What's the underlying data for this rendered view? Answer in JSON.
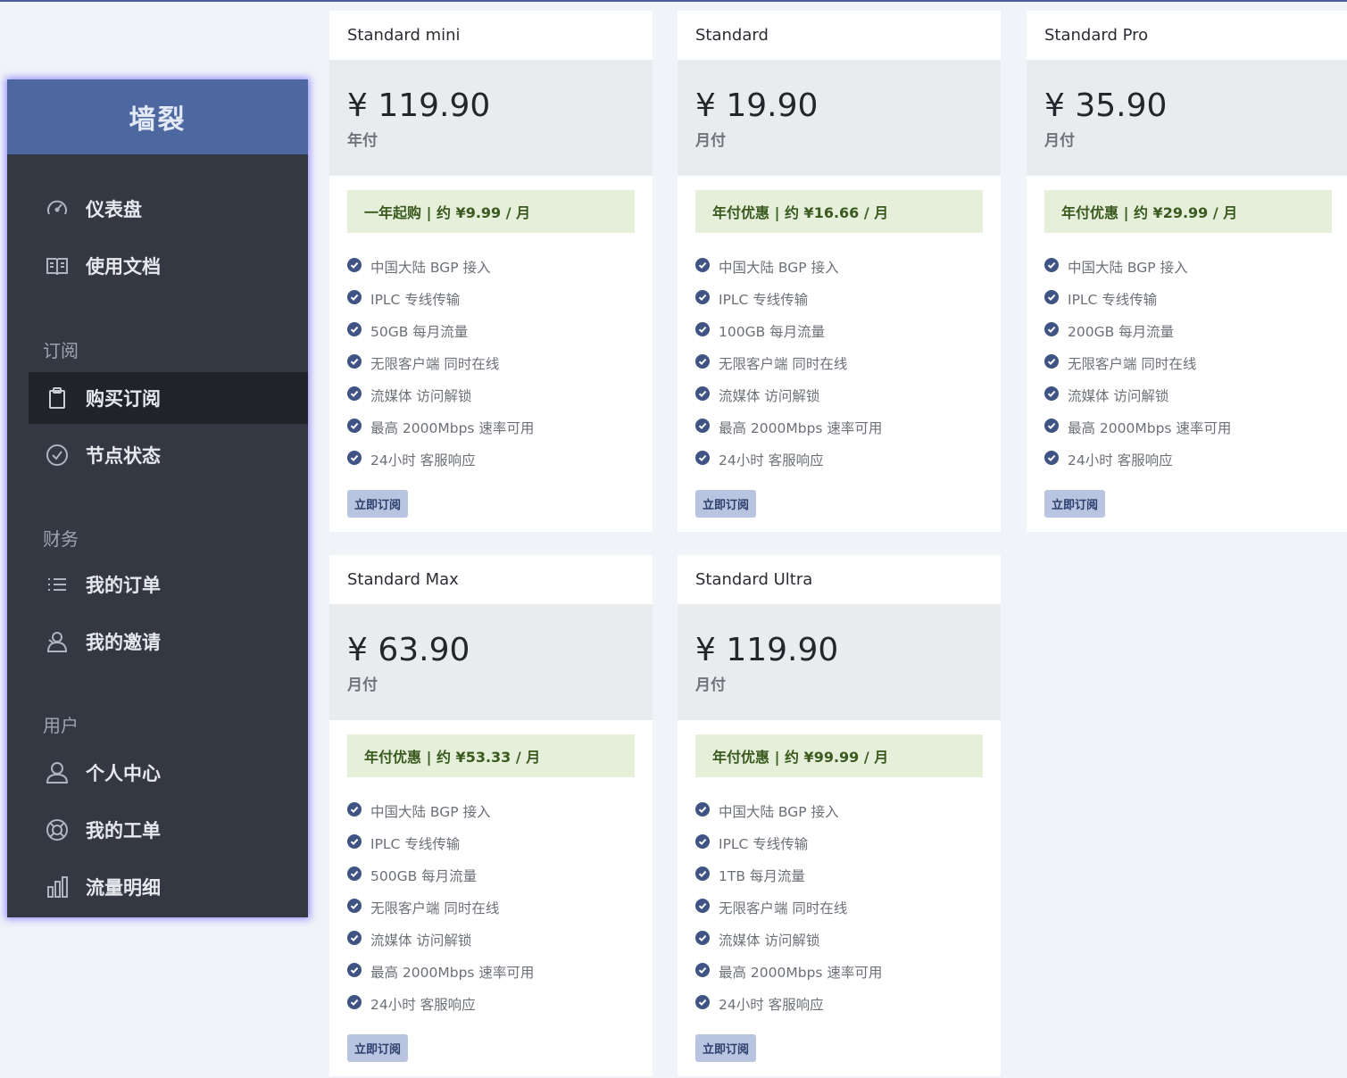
{
  "app": {
    "brand": "墙裂"
  },
  "sidebar": {
    "top_items": [
      {
        "label": "仪表盘",
        "icon": "gauge-icon"
      },
      {
        "label": "使用文档",
        "icon": "book-icon"
      }
    ],
    "sections": [
      {
        "title": "订阅",
        "items": [
          {
            "label": "购买订阅",
            "icon": "clipboard-icon",
            "active": true
          },
          {
            "label": "节点状态",
            "icon": "check-circle-icon"
          }
        ]
      },
      {
        "title": "财务",
        "items": [
          {
            "label": "我的订单",
            "icon": "list-icon"
          },
          {
            "label": "我的邀请",
            "icon": "users-icon"
          }
        ]
      },
      {
        "title": "用户",
        "items": [
          {
            "label": "个人中心",
            "icon": "user-icon"
          },
          {
            "label": "我的工单",
            "icon": "lifebuoy-icon"
          },
          {
            "label": "流量明细",
            "icon": "bar-chart-icon"
          }
        ]
      }
    ]
  },
  "plans": [
    {
      "name": "Standard mini",
      "price": "¥ 119.90",
      "period": "年付",
      "promo": "一年起购 | 约 ¥9.99 / 月",
      "features": [
        "中国大陆 BGP 接入",
        "IPLC 专线传输",
        "50GB 每月流量",
        "无限客户端 同时在线",
        "流媒体 访问解锁",
        "最高 2000Mbps 速率可用",
        "24小时 客服响应"
      ],
      "button": "立即订阅"
    },
    {
      "name": "Standard",
      "price": "¥ 19.90",
      "period": "月付",
      "promo": "年付优惠 | 约 ¥16.66 / 月",
      "features": [
        "中国大陆 BGP 接入",
        "IPLC 专线传输",
        "100GB 每月流量",
        "无限客户端 同时在线",
        "流媒体 访问解锁",
        "最高 2000Mbps 速率可用",
        "24小时 客服响应"
      ],
      "button": "立即订阅"
    },
    {
      "name": "Standard Pro",
      "price": "¥ 35.90",
      "period": "月付",
      "promo": "年付优惠 | 约 ¥29.99 / 月",
      "features": [
        "中国大陆 BGP 接入",
        "IPLC 专线传输",
        "200GB 每月流量",
        "无限客户端 同时在线",
        "流媒体 访问解锁",
        "最高 2000Mbps 速率可用",
        "24小时 客服响应"
      ],
      "button": "立即订阅"
    },
    {
      "name": "Standard Max",
      "price": "¥ 63.90",
      "period": "月付",
      "promo": "年付优惠 | 约 ¥53.33 / 月",
      "features": [
        "中国大陆 BGP 接入",
        "IPLC 专线传输",
        "500GB 每月流量",
        "无限客户端 同时在线",
        "流媒体 访问解锁",
        "最高 2000Mbps 速率可用",
        "24小时 客服响应"
      ],
      "button": "立即订阅"
    },
    {
      "name": "Standard Ultra",
      "price": "¥ 119.90",
      "period": "月付",
      "promo": "年付优惠 | 约 ¥99.99 / 月",
      "features": [
        "中国大陆 BGP 接入",
        "IPLC 专线传输",
        "1TB 每月流量",
        "无限客户端 同时在线",
        "流媒体 访问解锁",
        "最高 2000Mbps 速率可用",
        "24小时 客服响应"
      ],
      "button": "立即订阅"
    }
  ],
  "colors": {
    "brand_header": "#4d68a1",
    "sidebar_bg": "#343843",
    "promo_bg": "#e5efda",
    "check": "#3f5384",
    "button_bg": "#b8c4e0"
  }
}
